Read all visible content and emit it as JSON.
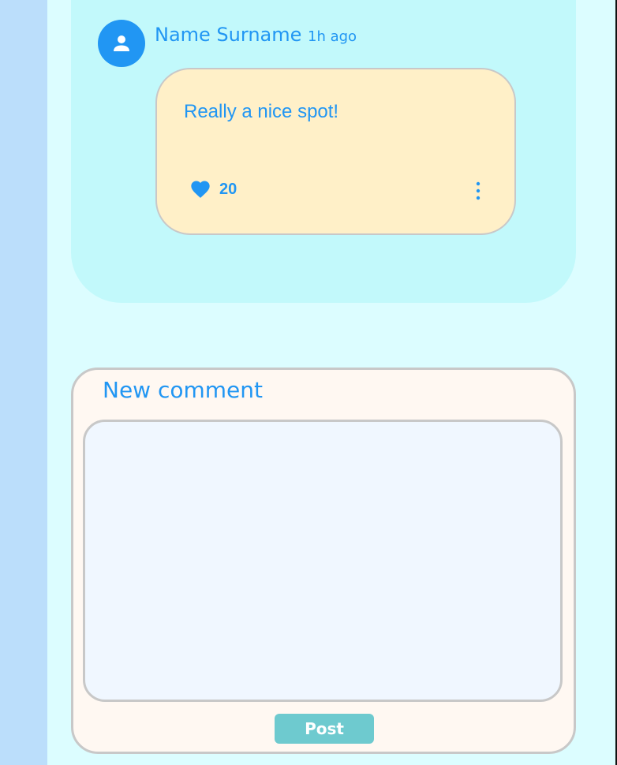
{
  "comment": {
    "author": "Name Surname",
    "time_ago": "1h ago",
    "text": "Really a nice spot!",
    "likes": "20",
    "avatar_icon": "person-icon",
    "like_icon": "heart-icon",
    "menu_icon": "more-vertical-icon"
  },
  "new_comment": {
    "title": "New comment",
    "input_value": "",
    "input_placeholder": "",
    "post_label": "Post"
  },
  "colors": {
    "accent": "#2196f3",
    "page_background": "#dcfdff",
    "left_rail": "#bbdefb",
    "comment_card": "#c2f9fb",
    "bubble": "#fff0c8",
    "panel": "#fff8f2",
    "input": "#f0f7ff",
    "post_button": "#6ecacf",
    "border": "#c8c8c8"
  }
}
